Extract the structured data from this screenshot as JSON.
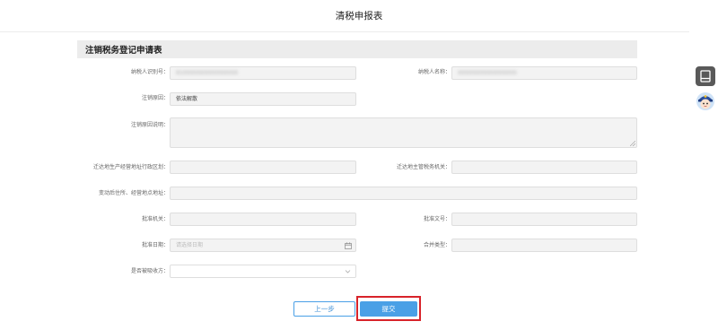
{
  "page": {
    "title": "清税申报表"
  },
  "section": {
    "title": "注销税务登记申请表"
  },
  "form": {
    "taxpayer_id": {
      "label": "纳税人识别号：",
      "value": "91XXXXXXXXXXXXXXX"
    },
    "taxpayer_name": {
      "label": "纳税人名称：",
      "value": "XXXXXXXXXXXXXXXX"
    },
    "cancel_reason": {
      "label": "注销原因：",
      "value": "依法解散"
    },
    "reason_explain": {
      "label": "注销原因说明：",
      "value": ""
    },
    "relocation_district": {
      "label": "迁达地生产经营地址行政区划：",
      "value": ""
    },
    "relocation_tax_authority": {
      "label": "迁达地主管税务机关：",
      "value": ""
    },
    "new_address": {
      "label": "变动后住所、经营地点地址：",
      "value": ""
    },
    "approving_authority": {
      "label": "批准机关：",
      "value": ""
    },
    "approval_doc_no": {
      "label": "批准文号：",
      "value": ""
    },
    "approval_date": {
      "label": "批准日期：",
      "placeholder": "请选择日期"
    },
    "merger_type": {
      "label": "合并类型：",
      "value": ""
    },
    "is_absorbing_party": {
      "label": "是否被吸收方：",
      "value": ""
    }
  },
  "buttons": {
    "prev": "上一步",
    "submit": "提交"
  },
  "icons": {
    "sidebar_top": "window-icon",
    "sidebar_avatar": "assistant-avatar-icon",
    "date": "calendar-icon",
    "select": "chevron-down-icon",
    "textarea": "resize-handle-icon"
  },
  "colors": {
    "primary": "#4aa0e6",
    "highlight": "#d8232a",
    "section_bg": "#ececec"
  }
}
